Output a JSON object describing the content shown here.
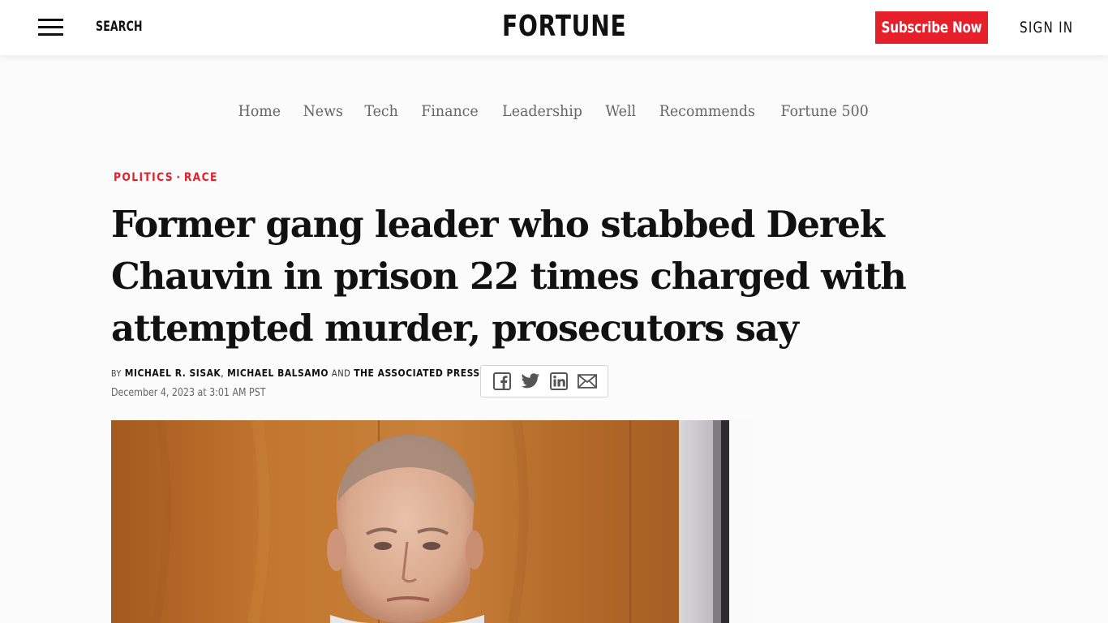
{
  "header": {
    "search_label": "SEARCH",
    "logo_text": "FORTUNE",
    "subscribe_label": "Subscribe Now",
    "signin_label": "SIGN IN",
    "accent_color": "#e5202b"
  },
  "nav": {
    "items": [
      "Home",
      "News",
      "Tech",
      "Finance",
      "Leadership",
      "Well",
      "Recommends",
      "Fortune 500"
    ]
  },
  "article": {
    "categories": [
      "POLITICS",
      "RACE"
    ],
    "category_separator": "·",
    "headline": "Former gang leader who stabbed Derek Chauvin in prison 22 times charged with attempted murder, prosecutors say",
    "byline": {
      "prefix": "BY",
      "authors": [
        "MICHAEL R. SISAK",
        "MICHAEL BALSAMO",
        "THE ASSOCIATED PRESS"
      ],
      "comma": ",",
      "conjunction": "AND"
    },
    "date": "December 4, 2023 at 3:01 AM PST",
    "share_icons": [
      "facebook-icon",
      "twitter-icon",
      "linkedin-icon",
      "email-icon"
    ]
  }
}
